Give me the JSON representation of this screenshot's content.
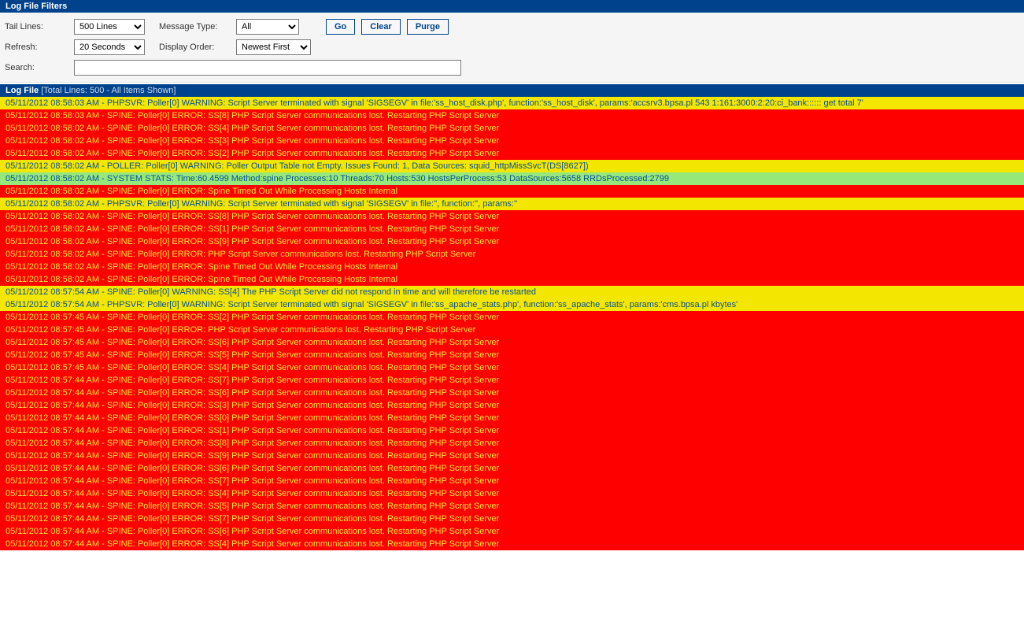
{
  "filters": {
    "header": "Log File Filters",
    "tail_lines": {
      "label": "Tail Lines:",
      "value": "500 Lines"
    },
    "message_type": {
      "label": "Message Type:",
      "value": "All"
    },
    "refresh": {
      "label": "Refresh:",
      "value": "20 Seconds"
    },
    "display_order": {
      "label": "Display Order:",
      "value": "Newest First"
    },
    "search": {
      "label": "Search:",
      "value": ""
    },
    "buttons": {
      "go": "Go",
      "clear": "Clear",
      "purge": "Purge"
    }
  },
  "log": {
    "header": "Log File",
    "header_sub": "[Total Lines: 500 - All Items Shown]",
    "rows": [
      {
        "level": "warn",
        "text": "05/11/2012 08:58:03 AM - PHPSVR: Poller[0] WARNING: Script Server terminated with signal 'SIGSEGV' in file:'ss_host_disk.php', function:'ss_host_disk', params:'accsrv3.bpsa.pl 543 1:161:3000:2:20:ci_bank:::::: get total 7'"
      },
      {
        "level": "error",
        "text": "05/11/2012 08:58:03 AM - SPINE: Poller[0] ERROR: SS[8] PHP Script Server communications lost. Restarting PHP Script Server"
      },
      {
        "level": "error",
        "text": "05/11/2012 08:58:02 AM - SPINE: Poller[0] ERROR: SS[4] PHP Script Server communications lost. Restarting PHP Script Server"
      },
      {
        "level": "error",
        "text": "05/11/2012 08:58:02 AM - SPINE: Poller[0] ERROR: SS[3] PHP Script Server communications lost. Restarting PHP Script Server"
      },
      {
        "level": "error",
        "text": "05/11/2012 08:58:02 AM - SPINE: Poller[0] ERROR: SS[2] PHP Script Server communications lost. Restarting PHP Script Server"
      },
      {
        "level": "warn",
        "text": "05/11/2012 08:58:02 AM - POLLER: Poller[0] WARNING: Poller Output Table not Empty. Issues Found: 1, Data Sources: squid_httpMissSvcT(DS[8627])"
      },
      {
        "level": "stats",
        "text": "05/11/2012 08:58:02 AM - SYSTEM STATS: Time:60.4599 Method:spine Processes:10 Threads:70 Hosts:530 HostsPerProcess:53 DataSources:5658 RRDsProcessed:2799"
      },
      {
        "level": "error",
        "text": "05/11/2012 08:58:02 AM - SPINE: Poller[0] ERROR: Spine Timed Out While Processing Hosts Internal"
      },
      {
        "level": "warn",
        "text": "05/11/2012 08:58:02 AM - PHPSVR: Poller[0] WARNING: Script Server terminated with signal 'SIGSEGV' in file:'', function:'', params:''"
      },
      {
        "level": "error",
        "text": "05/11/2012 08:58:02 AM - SPINE: Poller[0] ERROR: SS[8] PHP Script Server communications lost. Restarting PHP Script Server"
      },
      {
        "level": "error",
        "text": "05/11/2012 08:58:02 AM - SPINE: Poller[0] ERROR: SS[1] PHP Script Server communications lost. Restarting PHP Script Server"
      },
      {
        "level": "error",
        "text": "05/11/2012 08:58:02 AM - SPINE: Poller[0] ERROR: SS[9] PHP Script Server communications lost. Restarting PHP Script Server"
      },
      {
        "level": "error",
        "text": "05/11/2012 08:58:02 AM - SPINE: Poller[0] ERROR: PHP Script Server communications lost. Restarting PHP Script Server"
      },
      {
        "level": "error",
        "text": "05/11/2012 08:58:02 AM - SPINE: Poller[0] ERROR: Spine Timed Out While Processing Hosts Internal"
      },
      {
        "level": "error",
        "text": "05/11/2012 08:58:02 AM - SPINE: Poller[0] ERROR: Spine Timed Out While Processing Hosts Internal"
      },
      {
        "level": "warn",
        "text": "05/11/2012 08:57:54 AM - SPINE: Poller[0] WARNING: SS[4] The PHP Script Server did not respond in time and will therefore be restarted"
      },
      {
        "level": "warn",
        "text": "05/11/2012 08:57:54 AM - PHPSVR: Poller[0] WARNING: Script Server terminated with signal 'SIGSEGV' in file:'ss_apache_stats.php', function:'ss_apache_stats', params:'cms.bpsa.pl kbytes'"
      },
      {
        "level": "error",
        "text": "05/11/2012 08:57:45 AM - SPINE: Poller[0] ERROR: SS[2] PHP Script Server communications lost. Restarting PHP Script Server"
      },
      {
        "level": "error",
        "text": "05/11/2012 08:57:45 AM - SPINE: Poller[0] ERROR: PHP Script Server communications lost. Restarting PHP Script Server"
      },
      {
        "level": "error",
        "text": "05/11/2012 08:57:45 AM - SPINE: Poller[0] ERROR: SS[6] PHP Script Server communications lost. Restarting PHP Script Server"
      },
      {
        "level": "error",
        "text": "05/11/2012 08:57:45 AM - SPINE: Poller[0] ERROR: SS[5] PHP Script Server communications lost. Restarting PHP Script Server"
      },
      {
        "level": "error",
        "text": "05/11/2012 08:57:45 AM - SPINE: Poller[0] ERROR: SS[4] PHP Script Server communications lost. Restarting PHP Script Server"
      },
      {
        "level": "error",
        "text": "05/11/2012 08:57:44 AM - SPINE: Poller[0] ERROR: SS[7] PHP Script Server communications lost. Restarting PHP Script Server"
      },
      {
        "level": "error",
        "text": "05/11/2012 08:57:44 AM - SPINE: Poller[0] ERROR: SS[6] PHP Script Server communications lost. Restarting PHP Script Server"
      },
      {
        "level": "error",
        "text": "05/11/2012 08:57:44 AM - SPINE: Poller[0] ERROR: SS[3] PHP Script Server communications lost. Restarting PHP Script Server"
      },
      {
        "level": "error",
        "text": "05/11/2012 08:57:44 AM - SPINE: Poller[0] ERROR: SS[0] PHP Script Server communications lost. Restarting PHP Script Server"
      },
      {
        "level": "error",
        "text": "05/11/2012 08:57:44 AM - SPINE: Poller[0] ERROR: SS[1] PHP Script Server communications lost. Restarting PHP Script Server"
      },
      {
        "level": "error",
        "text": "05/11/2012 08:57:44 AM - SPINE: Poller[0] ERROR: SS[8] PHP Script Server communications lost. Restarting PHP Script Server"
      },
      {
        "level": "error",
        "text": "05/11/2012 08:57:44 AM - SPINE: Poller[0] ERROR: SS[9] PHP Script Server communications lost. Restarting PHP Script Server"
      },
      {
        "level": "error",
        "text": "05/11/2012 08:57:44 AM - SPINE: Poller[0] ERROR: SS[6] PHP Script Server communications lost. Restarting PHP Script Server"
      },
      {
        "level": "error",
        "text": "05/11/2012 08:57:44 AM - SPINE: Poller[0] ERROR: SS[7] PHP Script Server communications lost. Restarting PHP Script Server"
      },
      {
        "level": "error",
        "text": "05/11/2012 08:57:44 AM - SPINE: Poller[0] ERROR: SS[4] PHP Script Server communications lost. Restarting PHP Script Server"
      },
      {
        "level": "error",
        "text": "05/11/2012 08:57:44 AM - SPINE: Poller[0] ERROR: SS[5] PHP Script Server communications lost. Restarting PHP Script Server"
      },
      {
        "level": "error",
        "text": "05/11/2012 08:57:44 AM - SPINE: Poller[0] ERROR: SS[7] PHP Script Server communications lost. Restarting PHP Script Server"
      },
      {
        "level": "error",
        "text": "05/11/2012 08:57:44 AM - SPINE: Poller[0] ERROR: SS[6] PHP Script Server communications lost. Restarting PHP Script Server"
      },
      {
        "level": "error",
        "text": "05/11/2012 08:57:44 AM - SPINE: Poller[0] ERROR: SS[4] PHP Script Server communications lost. Restarting PHP Script Server"
      }
    ]
  }
}
